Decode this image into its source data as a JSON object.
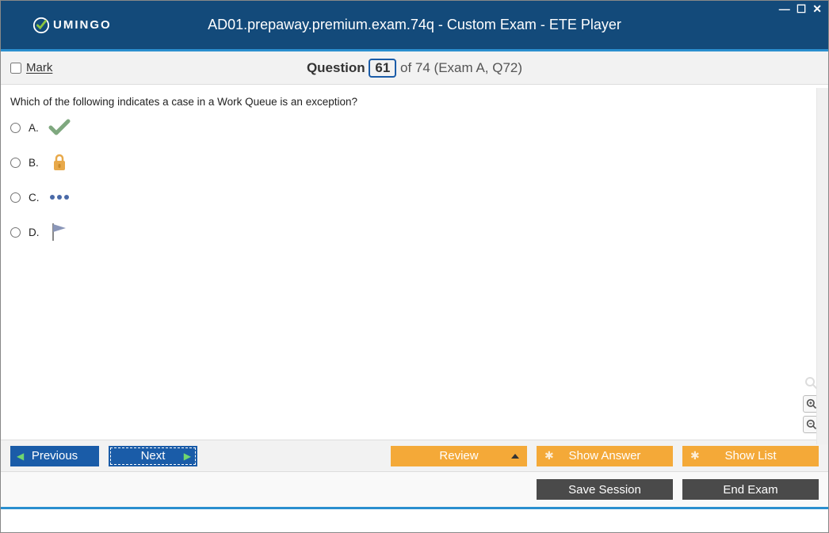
{
  "window": {
    "title": "AD01.prepaway.premium.exam.74q - Custom Exam - ETE Player",
    "logo_text": "UMINGO"
  },
  "header": {
    "mark_label": "Mark",
    "question_word": "Question",
    "question_number": "61",
    "of_text": "of 74 (Exam A, Q72)"
  },
  "question": {
    "text": "Which of the following indicates a case in a Work Queue is an exception?",
    "options": [
      {
        "letter": "A.",
        "icon": "checkmark-icon"
      },
      {
        "letter": "B.",
        "icon": "lock-icon"
      },
      {
        "letter": "C.",
        "icon": "dots-icon"
      },
      {
        "letter": "D.",
        "icon": "flag-icon"
      }
    ]
  },
  "buttons": {
    "previous": "Previous",
    "next": "Next",
    "review": "Review",
    "show_answer": "Show Answer",
    "show_list": "Show List",
    "save_session": "Save Session",
    "end_exam": "End Exam"
  }
}
